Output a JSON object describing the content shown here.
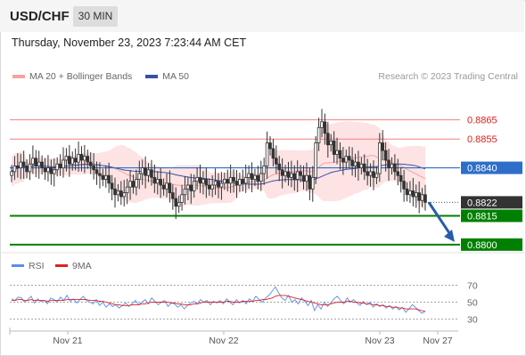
{
  "header": {
    "symbol": "USD/CHF",
    "timeframe": "30 MIN",
    "timestamp": "Thursday, November 23, 2023 7:23:44 AM CET"
  },
  "legend": {
    "ma20_label": "MA 20 + Bollinger Bands",
    "ma50_label": "MA 50",
    "copyright": "Research © 2023 Trading Central"
  },
  "rsi_legend": {
    "rsi_label": "RSI",
    "ma_label": "9MA"
  },
  "colors": {
    "resistance": "#f08080",
    "support": "#008000",
    "pivot": "#2e6ec9",
    "last_price": "#333333",
    "candle": "#333333",
    "candle_up": "#ffffff",
    "bollinger_fill": "#fde3e3",
    "ma20": "#f4a3a3",
    "ma50": "#3b4ea8",
    "arrow": "#2a5caa",
    "rsi": "#5b8def",
    "rsi_ma": "#e02020"
  },
  "chart_data": {
    "type": "candlestick",
    "y_range": [
      0.8786,
      0.8895
    ],
    "levels": [
      {
        "name": "resistance-2",
        "value": 0.8865,
        "label": "0.8865",
        "kind": "resistance"
      },
      {
        "name": "resistance-1",
        "value": 0.8855,
        "label": "0.8855",
        "kind": "resistance"
      },
      {
        "name": "pivot",
        "value": 0.884,
        "label": "0.8840",
        "kind": "pivot"
      },
      {
        "name": "last-price",
        "value": 0.8822,
        "label": "0.8822",
        "kind": "last"
      },
      {
        "name": "support-1",
        "value": 0.8815,
        "label": "0.8815",
        "kind": "support"
      },
      {
        "name": "support-2",
        "value": 0.88,
        "label": "0.8800",
        "kind": "support"
      }
    ],
    "x_tick_labels": [
      "Nov 21",
      "Nov 22",
      "Nov 23",
      "Nov 27"
    ],
    "close": [
      0.8838,
      0.8841,
      0.884,
      0.8843,
      0.8841,
      0.8838,
      0.8842,
      0.8845,
      0.8841,
      0.8843,
      0.884,
      0.8838,
      0.884,
      0.8837,
      0.8839,
      0.8842,
      0.884,
      0.8844,
      0.8846,
      0.8842,
      0.8845,
      0.8843,
      0.8847,
      0.8844,
      0.8846,
      0.8843,
      0.8841,
      0.8839,
      0.8837,
      0.8836,
      0.8834,
      0.8836,
      0.8832,
      0.8829,
      0.8826,
      0.8828,
      0.8825,
      0.8827,
      0.883,
      0.8833,
      0.883,
      0.8834,
      0.8837,
      0.884,
      0.8836,
      0.8839,
      0.8835,
      0.8832,
      0.8834,
      0.8831,
      0.8829,
      0.8832,
      0.8827,
      0.8824,
      0.882,
      0.8822,
      0.8826,
      0.8829,
      0.8831,
      0.8828,
      0.8833,
      0.8835,
      0.8832,
      0.8834,
      0.8831,
      0.8829,
      0.8831,
      0.8833,
      0.883,
      0.8832,
      0.8834,
      0.8832,
      0.8835,
      0.8833,
      0.8831,
      0.8834,
      0.8832,
      0.8835,
      0.8837,
      0.8834,
      0.8836,
      0.8833,
      0.8837,
      0.8841,
      0.8853,
      0.885,
      0.8845,
      0.8842,
      0.8839,
      0.8836,
      0.8838,
      0.8835,
      0.8837,
      0.8834,
      0.8838,
      0.8836,
      0.8833,
      0.8836,
      0.8829,
      0.8835,
      0.8853,
      0.8861,
      0.8864,
      0.8858,
      0.8852,
      0.8854,
      0.8847,
      0.8849,
      0.8845,
      0.8843,
      0.8846,
      0.8844,
      0.8841,
      0.8843,
      0.884,
      0.8842,
      0.8838,
      0.8836,
      0.8838,
      0.8835,
      0.8837,
      0.8853,
      0.8849,
      0.8844,
      0.884,
      0.8842,
      0.8838,
      0.8836,
      0.8833,
      0.8829,
      0.8826,
      0.8828,
      0.8825,
      0.8827,
      0.8823,
      0.8826,
      0.8822
    ],
    "rsi_axis": [
      30,
      50,
      70
    ],
    "rsi_range": [
      20,
      80
    ],
    "rsi": [
      54,
      52,
      56,
      55,
      50,
      53,
      57,
      49,
      54,
      51,
      52,
      48,
      55,
      53,
      50,
      56,
      52,
      58,
      51,
      54,
      49,
      53,
      57,
      52,
      50,
      48,
      53,
      46,
      50,
      44,
      48,
      45,
      47,
      43,
      46,
      49,
      45,
      48,
      52,
      47,
      50,
      53,
      48,
      55,
      51,
      47,
      50,
      52,
      45,
      49,
      48,
      44,
      47,
      42,
      46,
      49,
      51,
      48,
      53,
      50,
      52,
      47,
      51,
      49,
      52,
      48,
      54,
      50,
      47,
      53,
      49,
      52,
      48,
      54,
      51,
      57,
      53,
      50,
      55,
      58,
      63,
      68,
      61,
      55,
      52,
      58,
      50,
      53,
      48,
      55,
      51,
      46,
      52,
      40,
      47,
      42,
      50,
      45,
      49,
      54,
      57,
      52,
      48,
      55,
      50,
      53,
      49,
      46,
      51,
      47,
      50,
      44,
      48,
      45,
      47,
      43,
      46,
      42,
      45,
      41,
      44,
      38,
      42,
      47,
      44,
      40,
      37,
      39
    ],
    "rsi_ma": [
      52,
      52,
      53,
      53,
      52,
      52,
      53,
      52,
      52,
      52,
      52,
      51,
      52,
      52,
      52,
      52,
      52,
      53,
      53,
      53,
      53,
      53,
      53,
      53,
      52,
      52,
      52,
      51,
      51,
      50,
      49,
      48,
      47,
      47,
      46,
      46,
      46,
      47,
      47,
      47,
      48,
      48,
      49,
      50,
      50,
      50,
      50,
      50,
      50,
      49,
      49,
      48,
      48,
      47,
      47,
      47,
      48,
      48,
      49,
      50,
      50,
      50,
      50,
      50,
      50,
      50,
      51,
      51,
      50,
      50,
      50,
      51,
      51,
      51,
      51,
      52,
      52,
      53,
      53,
      54,
      55,
      57,
      58,
      58,
      58,
      57,
      56,
      55,
      54,
      53,
      52,
      51,
      50,
      49,
      48,
      47,
      47,
      47,
      48,
      49,
      50,
      50,
      50,
      51,
      51,
      50,
      50,
      49,
      49,
      48,
      48,
      47,
      47,
      46,
      46,
      45,
      45,
      44,
      44,
      43,
      43,
      42,
      42,
      42,
      42,
      41,
      40,
      39
    ]
  }
}
